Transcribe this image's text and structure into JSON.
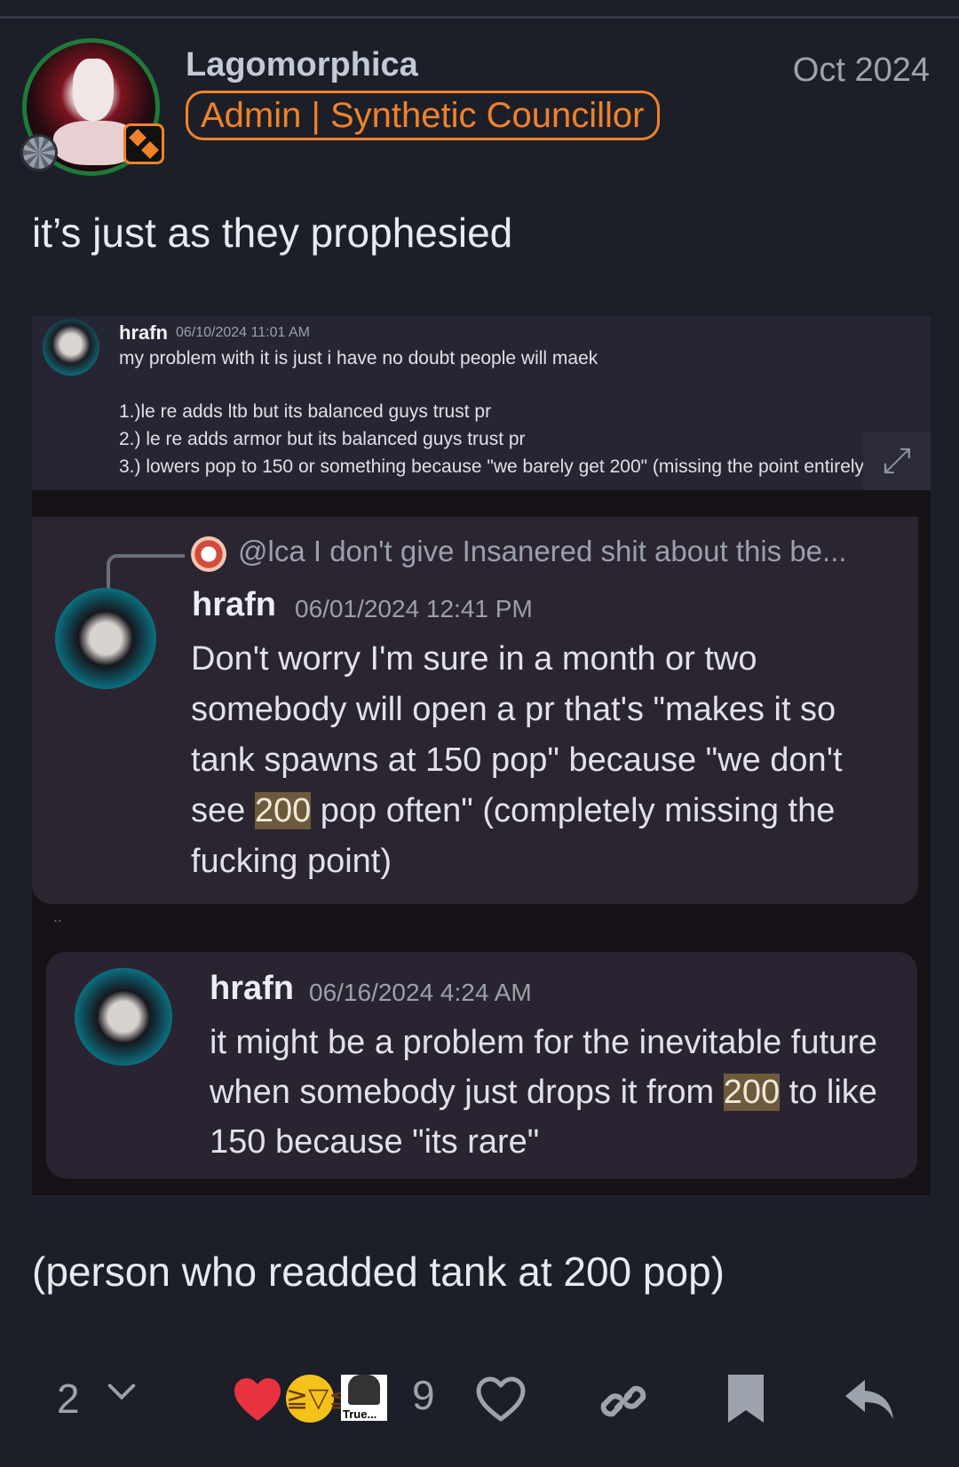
{
  "post": {
    "author": "Lagomorphica",
    "user_title": "Admin | Synthetic Councillor",
    "date": "Oct 2024",
    "text_before": "it’s just as they prophesied",
    "text_after": "(person who readded tank at 200 pop)"
  },
  "screenshot": {
    "msg1": {
      "user": "hrafn",
      "time": "06/10/2024 11:01 AM",
      "lines": [
        "my problem with it is just i have no doubt people will maek",
        "1.)le re adds ltb but its balanced guys trust pr",
        "2.) le re adds armor but its balanced guys trust pr",
        "3.) lowers pop to 150 or something because \"we barely get 200\" (missing the point entirely)"
      ]
    },
    "msg2": {
      "reply_preview": "@lca I don't give Insanered shit about this be...",
      "user": "hrafn",
      "time": "06/01/2024 12:41 PM",
      "body_pre": "Don't worry I'm sure in a month or two somebody will open a pr that's \"makes it so tank spawns at 150 pop\" because \"we don't see ",
      "highlight": "200",
      "body_post": " pop often\" (completely missing the fucking point)"
    },
    "separator": "..",
    "msg3": {
      "user": "hrafn",
      "time": "06/16/2024 4:24 AM",
      "body_pre": "it might be a problem for the inevitable future when somebody just drops it from ",
      "highlight": "200",
      "body_post": " to like 150 because \"its rare\""
    }
  },
  "actions": {
    "replies_count": "2",
    "reaction_count": "9",
    "emoji_label": "True...",
    "icons": [
      "chevron-down-icon",
      "heart-emoji-icon",
      "laugh-emoji-icon",
      "true-emoji-icon",
      "like-icon",
      "link-icon",
      "bookmark-icon",
      "reply-icon"
    ],
    "colors": {
      "accent": "#f0822a",
      "heart": "#e8323f",
      "background": "#1c1f28"
    }
  }
}
